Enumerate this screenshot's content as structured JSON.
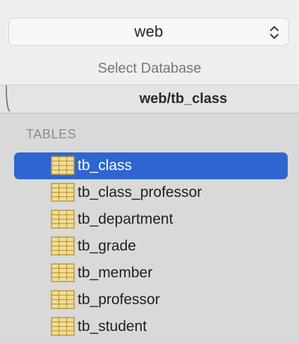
{
  "database_selector": {
    "value": "web",
    "caption": "Select Database",
    "chevron_icon": "up-down-chevron-icon"
  },
  "tab": {
    "title": "web/tb_class"
  },
  "tables": {
    "header": "TABLES",
    "selected_index": 0,
    "icon": "table-grid-icon",
    "items": [
      {
        "label": "tb_class"
      },
      {
        "label": "tb_class_professor"
      },
      {
        "label": "tb_department"
      },
      {
        "label": "tb_grade"
      },
      {
        "label": "tb_member"
      },
      {
        "label": "tb_professor"
      },
      {
        "label": "tb_student"
      }
    ]
  },
  "colors": {
    "selection": "#2f65d0",
    "table_icon_fill": "#f3de96",
    "table_icon_stroke": "#b89a3c"
  }
}
